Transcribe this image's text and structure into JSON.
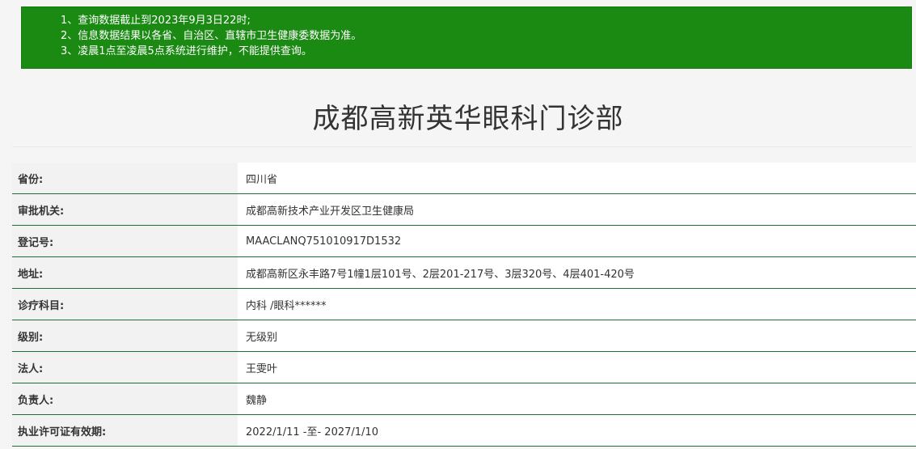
{
  "notice": {
    "items": [
      "1、查询数据截止到2023年9月3日22时;",
      "2、信息数据结果以各省、自治区、直辖市卫生健康委数据为准。",
      "3、凌晨1点至凌晨5点系统进行维护，不能提供查询。"
    ]
  },
  "page": {
    "title": "成都高新英华眼科门诊部"
  },
  "details": {
    "rows": [
      {
        "label": "省份:",
        "value": "四川省"
      },
      {
        "label": "审批机关:",
        "value": "成都高新技术产业开发区卫生健康局"
      },
      {
        "label": "登记号:",
        "value": "MAACLANQ751010917D1532"
      },
      {
        "label": "地址:",
        "value": "成都高新区永丰路7号1幢1层101号、2层201-217号、3层320号、4层401-420号"
      },
      {
        "label": "诊疗科目:",
        "value": "内科 /眼科******"
      },
      {
        "label": "级别:",
        "value": "无级别"
      },
      {
        "label": "法人:",
        "value": "王雯叶"
      },
      {
        "label": "负责人:",
        "value": "魏静"
      },
      {
        "label": "执业许可证有效期:",
        "value": "2022/1/11 -至- 2027/1/10"
      }
    ]
  },
  "colors": {
    "notice_background": "#1a8a13",
    "row_border": "#1a6f3c"
  }
}
